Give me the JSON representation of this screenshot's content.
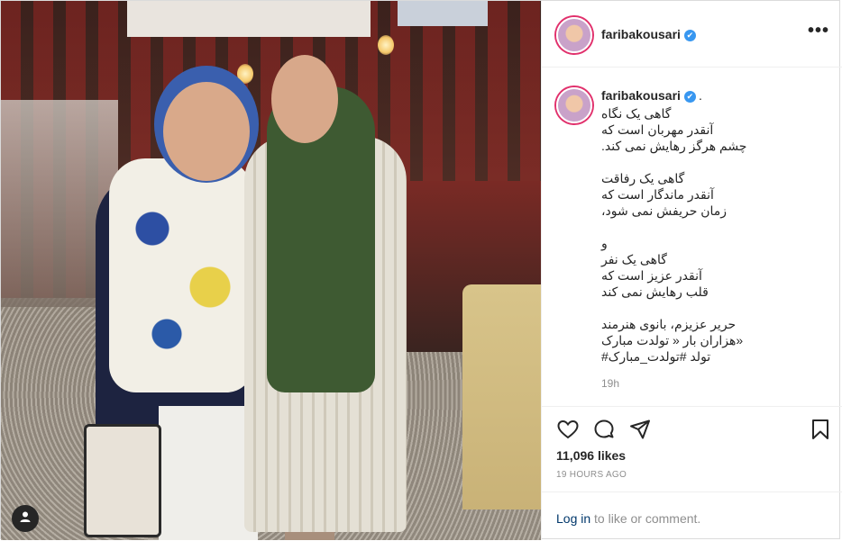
{
  "post": {
    "username": "faribakousari",
    "verified_symbol": "✔",
    "more_label": "•••",
    "caption_dot": ".",
    "caption_lines": [
      "گاهی یک نگاه",
      "آنقدر مهربان است که",
      "چشم هرگز رهایش نمی کند.",
      "",
      "گاهی یک رفاقت",
      "آنقدر ماندگار است که",
      "زمان حریفش نمی شود،",
      "",
      "و",
      "گاهی یک نفر",
      "آنقدر عزیز است که",
      "قلب رهایش نمی کند",
      "",
      "حریر عزیزم، بانوی هنرمند",
      "«هزاران بار « تولدت مبارک",
      "تولد #تولدت_مبارک#"
    ],
    "relative_time": "19h",
    "likes": "11,096 likes",
    "posted_ago": "19 HOURS AGO"
  },
  "icons": {
    "like": "heart-icon",
    "comment": "comment-icon",
    "share": "share-icon",
    "save": "bookmark-icon",
    "more": "more-icon",
    "tagged_user": "user-icon"
  },
  "footer": {
    "login_link": "Log in",
    "login_rest": " to like or comment."
  },
  "colors": {
    "verified": "#3897f0",
    "link": "#00376b",
    "muted": "#8e8e8e",
    "text": "#262626"
  }
}
